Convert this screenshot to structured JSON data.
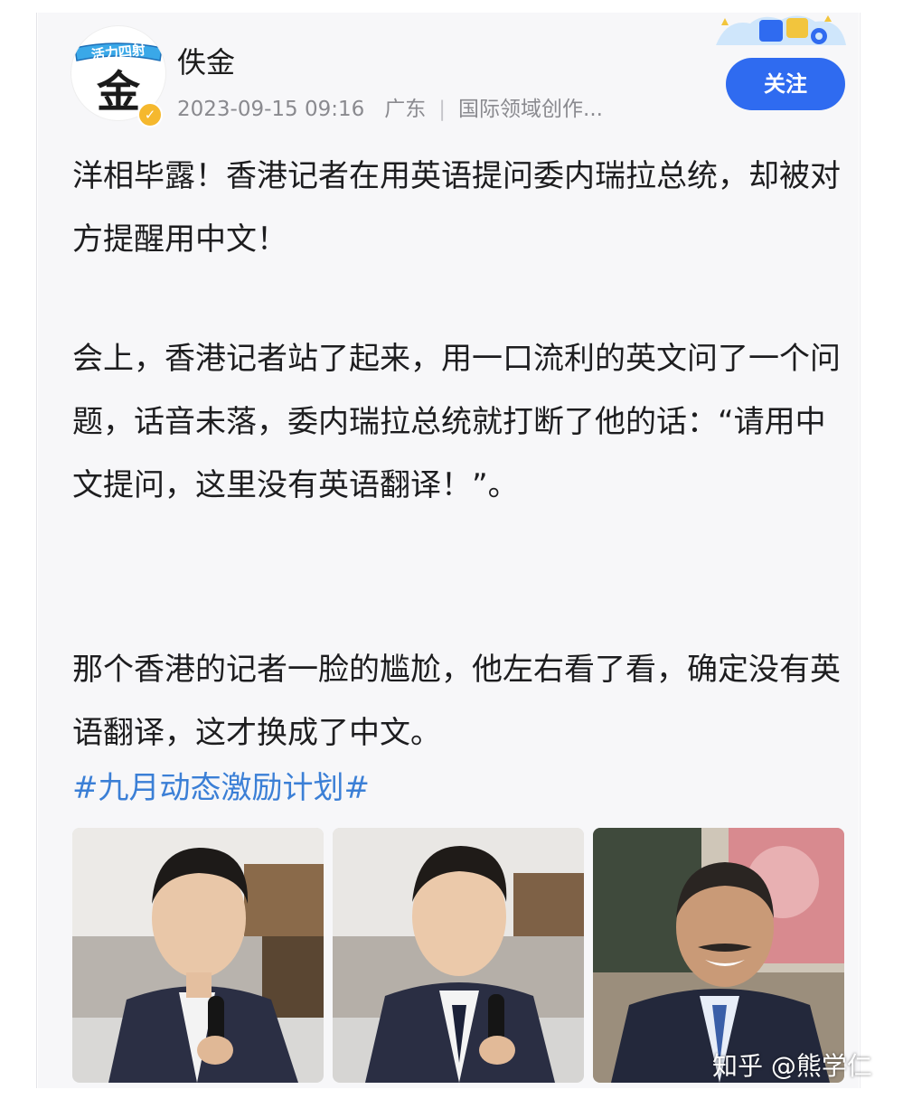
{
  "post": {
    "avatar_banner": "活力四射",
    "avatar_glyph": "金",
    "author": "佚金",
    "verified_icon": "✓",
    "datetime": "2023-09-15 09:16",
    "location": "广东",
    "meta_separator": "|",
    "author_tag": "国际领域创作...",
    "follow_label": "关注",
    "paragraphs": [
      "洋相毕露！香港记者在用英语提问委内瑞拉总统，却被对方提醒用中文！",
      "会上，香港记者站了起来，用一口流利的英文问了一个问题，话音未落，委内瑞拉总统就打断了他的话：“请用中文提问，这里没有英语翻译！”。",
      "那个香港的记者一脸的尴尬，他左右看了看，确定没有英语翻译，这才换成了中文。"
    ],
    "topic": "#九月动态激励计划#",
    "images": [
      {
        "name": "reporter-photo-1"
      },
      {
        "name": "reporter-photo-2"
      },
      {
        "name": "president-photo"
      }
    ]
  },
  "watermark": "知乎 @熊学仁",
  "colors": {
    "accent": "#2f6bf0",
    "topic": "#3b7fd6",
    "meta": "#8a8a8f",
    "verified": "#f5b82e"
  }
}
